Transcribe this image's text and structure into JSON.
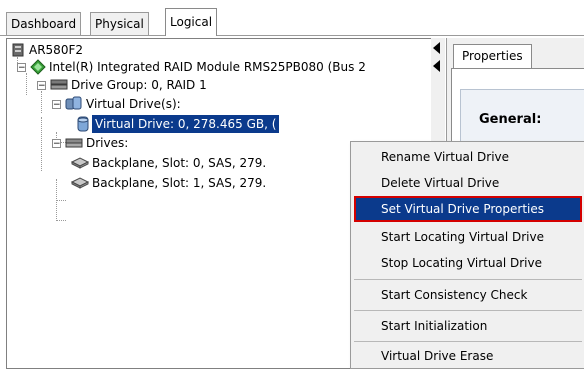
{
  "tabs": [
    {
      "label": "Dashboard"
    },
    {
      "label": "Physical"
    },
    {
      "label": "Logical"
    }
  ],
  "tree": {
    "root": "AR580F2",
    "controller": "Intel(R) Integrated RAID Module RMS25PB080 (Bus 2",
    "drive_group": "Drive Group: 0, RAID  1",
    "virtual_drives": "Virtual Drive(s):",
    "virtual_drive": "Virtual Drive: 0, 278.465 GB, (",
    "drives": "Drives:",
    "backplane_0": "Backplane, Slot: 0, SAS, 279.",
    "backplane_1": "Backplane, Slot: 1, SAS, 279."
  },
  "properties": {
    "tab": "Properties",
    "section": "General:"
  },
  "context_menu": {
    "items": [
      {
        "label": "Rename Virtual Drive"
      },
      {
        "label": "Delete Virtual Drive"
      },
      {
        "label": "Set Virtual Drive Properties",
        "highlighted": true
      },
      {
        "label": "Start Locating Virtual Drive"
      },
      {
        "label": "Stop Locating Virtual Drive"
      },
      {
        "label": "Start Consistency Check"
      },
      {
        "label": "Start Initialization"
      },
      {
        "label": "Virtual Drive Erase"
      }
    ]
  },
  "colors": {
    "selection": "#0b3a8c",
    "highlight_outline": "#d40000"
  }
}
